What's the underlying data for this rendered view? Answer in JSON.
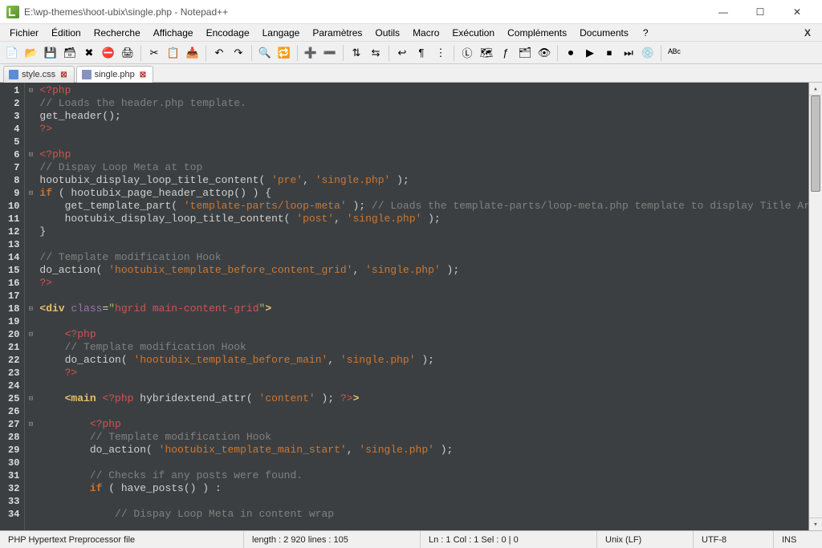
{
  "window": {
    "title": "E:\\wp-themes\\hoot-ubix\\single.php - Notepad++"
  },
  "menus": [
    "Fichier",
    "Édition",
    "Recherche",
    "Affichage",
    "Encodage",
    "Langage",
    "Paramètres",
    "Outils",
    "Macro",
    "Exécution",
    "Compléments",
    "Documents",
    "?"
  ],
  "toolbar_icons": [
    {
      "name": "new-file-icon",
      "glyph": "📄"
    },
    {
      "name": "open-file-icon",
      "glyph": "📂"
    },
    {
      "name": "save-icon",
      "glyph": "💾"
    },
    {
      "name": "save-all-icon",
      "glyph": "🗃"
    },
    {
      "name": "close-icon",
      "glyph": "✖"
    },
    {
      "name": "close-all-icon",
      "glyph": "⛔"
    },
    {
      "name": "print-icon",
      "glyph": "🖨"
    },
    {
      "name": "sep"
    },
    {
      "name": "cut-icon",
      "glyph": "✂"
    },
    {
      "name": "copy-icon",
      "glyph": "📋"
    },
    {
      "name": "paste-icon",
      "glyph": "📥"
    },
    {
      "name": "sep"
    },
    {
      "name": "undo-icon",
      "glyph": "↶"
    },
    {
      "name": "redo-icon",
      "glyph": "↷"
    },
    {
      "name": "sep"
    },
    {
      "name": "find-icon",
      "glyph": "🔍"
    },
    {
      "name": "replace-icon",
      "glyph": "🔁"
    },
    {
      "name": "sep"
    },
    {
      "name": "zoom-in-icon",
      "glyph": "➕"
    },
    {
      "name": "zoom-out-icon",
      "glyph": "➖"
    },
    {
      "name": "sep"
    },
    {
      "name": "sync-v-icon",
      "glyph": "⇅"
    },
    {
      "name": "sync-h-icon",
      "glyph": "⇆"
    },
    {
      "name": "sep"
    },
    {
      "name": "wrap-icon",
      "glyph": "↩"
    },
    {
      "name": "all-chars-icon",
      "glyph": "¶"
    },
    {
      "name": "indent-guide-icon",
      "glyph": "⋮"
    },
    {
      "name": "sep"
    },
    {
      "name": "lang-icon",
      "glyph": "Ⓛ"
    },
    {
      "name": "doc-map-icon",
      "glyph": "🗺"
    },
    {
      "name": "func-list-icon",
      "glyph": "ƒ"
    },
    {
      "name": "folder-tree-icon",
      "glyph": "🗂"
    },
    {
      "name": "monitor-icon",
      "glyph": "👁"
    },
    {
      "name": "sep"
    },
    {
      "name": "record-icon",
      "glyph": "⏺"
    },
    {
      "name": "play-icon",
      "glyph": "▶"
    },
    {
      "name": "stop-icon",
      "glyph": "⏹"
    },
    {
      "name": "play-multi-icon",
      "glyph": "⏭"
    },
    {
      "name": "save-macro-icon",
      "glyph": "💿"
    },
    {
      "name": "sep"
    },
    {
      "name": "spellcheck-icon",
      "glyph": "ᴬᴮᶜ"
    }
  ],
  "tabs": [
    {
      "label": "style.css",
      "active": false,
      "icon": "css"
    },
    {
      "label": "single.php",
      "active": true,
      "icon": "php"
    }
  ],
  "code_lines": [
    {
      "n": 1,
      "fold": true,
      "html": "<span class='c-red'>&lt;?php</span>"
    },
    {
      "n": 2,
      "html": "<span class='c-comment'>// Loads the header.php template.</span>"
    },
    {
      "n": 3,
      "html": "<span class='c-func'>get_header</span><span class='c-punc'>();</span>"
    },
    {
      "n": 4,
      "html": "<span class='c-red'>?&gt;</span>"
    },
    {
      "n": 5,
      "html": ""
    },
    {
      "n": 6,
      "fold": true,
      "html": "<span class='c-red'>&lt;?php</span>"
    },
    {
      "n": 7,
      "html": "<span class='c-comment'>// Dispay Loop Meta at top</span>"
    },
    {
      "n": 8,
      "html": "<span class='c-func'>hootubix_display_loop_title_content</span><span class='c-punc'>( </span><span class='c-str'>'pre'</span><span class='c-punc'>, </span><span class='c-str'>'single.php'</span><span class='c-punc'> );</span>"
    },
    {
      "n": 9,
      "fold": true,
      "html": "<span class='c-kw'>if</span><span class='c-punc'> ( </span><span class='c-func'>hootubix_page_header_attop</span><span class='c-punc'>() ) {</span>"
    },
    {
      "n": 10,
      "html": "    <span class='c-func'>get_template_part</span><span class='c-punc'>( </span><span class='c-str'>'template-parts/loop-meta'</span><span class='c-punc'> ); </span><span class='c-comment'>// Loads the template-parts/loop-meta.php template to display Title Area with Meta Info (of the loop)</span>"
    },
    {
      "n": 11,
      "html": "    <span class='c-func'>hootubix_display_loop_title_content</span><span class='c-punc'>( </span><span class='c-str'>'post'</span><span class='c-punc'>, </span><span class='c-str'>'single.php'</span><span class='c-punc'> );</span>"
    },
    {
      "n": 12,
      "html": "<span class='c-punc'>}</span>"
    },
    {
      "n": 13,
      "html": ""
    },
    {
      "n": 14,
      "html": "<span class='c-comment'>// Template modification Hook</span>"
    },
    {
      "n": 15,
      "html": "<span class='c-func'>do_action</span><span class='c-punc'>( </span><span class='c-str'>'hootubix_template_before_content_grid'</span><span class='c-punc'>, </span><span class='c-str'>'single.php'</span><span class='c-punc'> );</span>"
    },
    {
      "n": 16,
      "html": "<span class='c-red'>?&gt;</span>"
    },
    {
      "n": 17,
      "html": ""
    },
    {
      "n": 18,
      "fold": true,
      "html": "<span class='c-tag'>&lt;div</span> <span class='c-attr'>class</span><span class='c-punc'>=</span><span class='c-str2'>\"</span><span class='c-red'>hgrid main-content-grid</span><span class='c-str2'>\"</span><span class='c-tag'>&gt;</span>"
    },
    {
      "n": 19,
      "html": ""
    },
    {
      "n": 20,
      "fold": true,
      "html": "    <span class='c-red'>&lt;?php</span>"
    },
    {
      "n": 21,
      "html": "    <span class='c-comment'>// Template modification Hook</span>"
    },
    {
      "n": 22,
      "html": "    <span class='c-func'>do_action</span><span class='c-punc'>( </span><span class='c-str'>'hootubix_template_before_main'</span><span class='c-punc'>, </span><span class='c-str'>'single.php'</span><span class='c-punc'> );</span>"
    },
    {
      "n": 23,
      "html": "    <span class='c-red'>?&gt;</span>"
    },
    {
      "n": 24,
      "html": ""
    },
    {
      "n": 25,
      "fold": true,
      "html": "    <span class='c-tag'>&lt;main</span> <span class='c-red'>&lt;?php</span> <span class='c-func'>hybridextend_attr</span><span class='c-punc'>( </span><span class='c-str'>'content'</span><span class='c-punc'> ); </span><span class='c-red'>?&gt;</span><span class='c-tag'>&gt;</span>"
    },
    {
      "n": 26,
      "html": ""
    },
    {
      "n": 27,
      "fold": true,
      "html": "        <span class='c-red'>&lt;?php</span>"
    },
    {
      "n": 28,
      "html": "        <span class='c-comment'>// Template modification Hook</span>"
    },
    {
      "n": 29,
      "html": "        <span class='c-func'>do_action</span><span class='c-punc'>( </span><span class='c-str'>'hootubix_template_main_start'</span><span class='c-punc'>, </span><span class='c-str'>'single.php'</span><span class='c-punc'> );</span>"
    },
    {
      "n": 30,
      "html": ""
    },
    {
      "n": 31,
      "html": "        <span class='c-comment'>// Checks if any posts were found.</span>"
    },
    {
      "n": 32,
      "html": "        <span class='c-kw'>if</span><span class='c-punc'> ( </span><span class='c-func'>have_posts</span><span class='c-punc'>() ) :</span>"
    },
    {
      "n": 33,
      "html": ""
    },
    {
      "n": 34,
      "html": "            <span class='c-comment'>// Dispay Loop Meta in content wrap</span>"
    }
  ],
  "status": {
    "filetype": "PHP Hypertext Preprocessor file",
    "length": "length : 2 920    lines : 105",
    "pos": "Ln : 1    Col : 1    Sel : 0 | 0",
    "eol": "Unix (LF)",
    "encoding": "UTF-8",
    "insert": "INS"
  }
}
